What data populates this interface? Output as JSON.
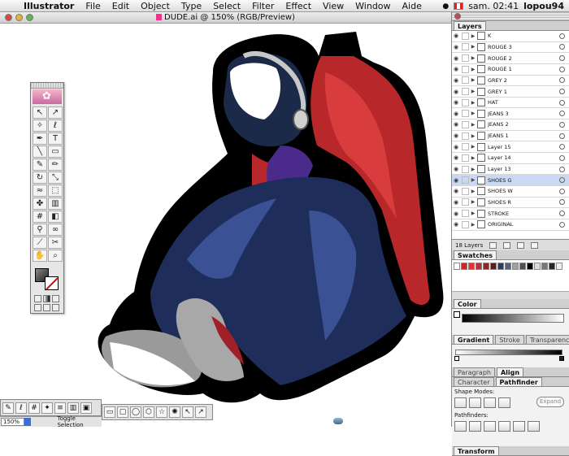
{
  "menubar": {
    "app": "Illustrator",
    "items": [
      "File",
      "Edit",
      "Object",
      "Type",
      "Select",
      "Filter",
      "Effect",
      "View",
      "Window",
      "Aide"
    ],
    "clock": "sam. 02:41",
    "user": "lopou94"
  },
  "document": {
    "title": "DUDE.ai @ 150% (RGB/Preview)"
  },
  "layers_panel": {
    "tab": "Layers",
    "layers": [
      "K",
      "ROUGE 3",
      "ROUGE 2",
      "ROUGE 1",
      "GREY 2",
      "GREY 1",
      "HAT",
      "JEANS 3",
      "JEANS 2",
      "JEANS 1",
      "Layer 15",
      "Layer 14",
      "Layer 13",
      "SHOES G",
      "SHOES W",
      "SHOES R",
      "STROKE",
      "ORIGINAL"
    ],
    "selected": "SHOES G",
    "count": "18 Layers"
  },
  "swatches_panel": {
    "tab": "Swatches",
    "colors": [
      "#ffffff",
      "#c8281e",
      "#e6322d",
      "#b4323c",
      "#8c2828",
      "#5a1e1e",
      "#323c5a",
      "#5a6478",
      "#a0a0a0",
      "#505050",
      "#000000",
      "#dcdcdc",
      "#787878",
      "#282828",
      "#f0f0f0"
    ]
  },
  "color_panel": {
    "tab": "Color"
  },
  "gradient_panel": {
    "tabs": [
      "Gradient",
      "Stroke",
      "Transparency"
    ]
  },
  "align_panel": {
    "tabs": [
      "Paragraph",
      "Align"
    ]
  },
  "pathfinder_panel": {
    "tabs": [
      "Character",
      "Pathfinder"
    ],
    "shape_modes_label": "Shape Modes:",
    "pathfinders_label": "Pathfinders:",
    "expand_label": "Expand"
  },
  "transform_panel": {
    "tab": "Transform"
  },
  "statusbar": {
    "zoom": "150%",
    "selection": "Toggle Selection"
  },
  "colors": {
    "jeans": "#1e2d5a",
    "jeans_light": "#3a5294",
    "jacket": "#b8282a",
    "jacket_light": "#d83c3c",
    "hat": "#1a2a48",
    "outline": "#000000",
    "shoe_grey": "#9a9a9a",
    "purple": "#4a2a8a"
  }
}
